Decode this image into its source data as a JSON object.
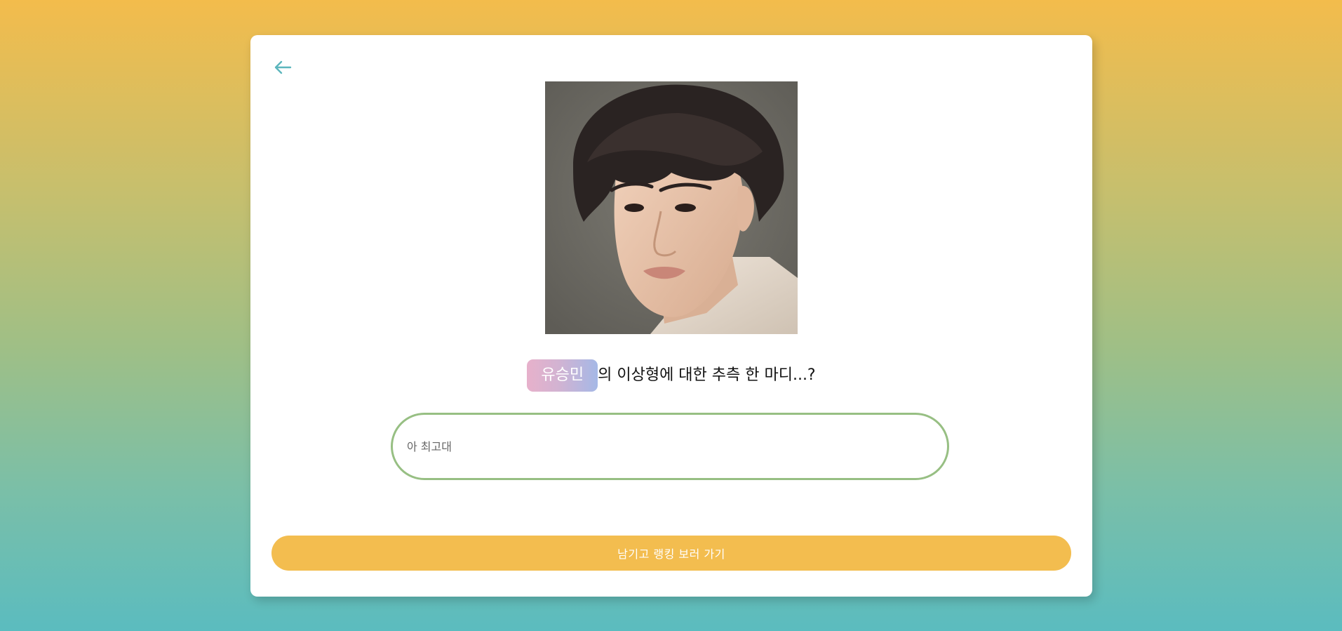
{
  "back_icon": "arrow-left-icon",
  "colors": {
    "accent": "#f3bd4f",
    "back_arrow": "#5cb6bd",
    "input_border": "#97bf83",
    "badge_gradient_start": "#e7b1cb",
    "badge_gradient_end": "#a5b8e6"
  },
  "question": {
    "name": "유승민",
    "text": "의 이상형에 대한 추측 한 마디...?"
  },
  "answer": {
    "value": "",
    "placeholder": "아 최고대"
  },
  "submit_label": "남기고 랭킹 보러 가기"
}
